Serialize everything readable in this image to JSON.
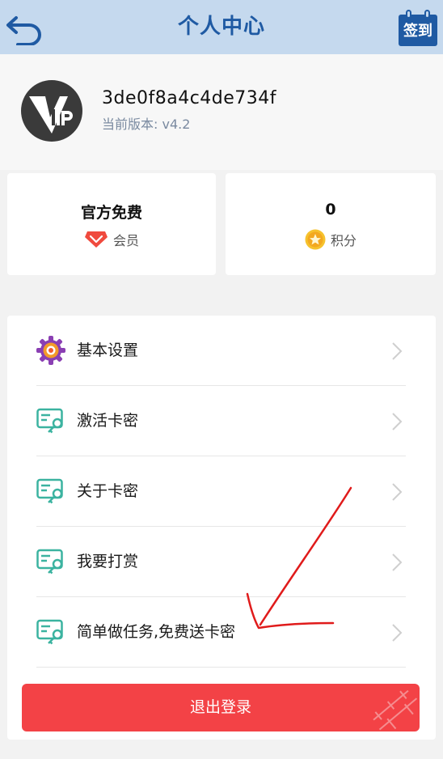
{
  "header": {
    "title": "个人中心",
    "checkin_label": "签到",
    "back_icon": "back-arrow-icon"
  },
  "profile": {
    "username": "3de0f8a4c4de734f",
    "version": "当前版本: v4.2",
    "avatar_icon": "vip-avatar-icon"
  },
  "stats": {
    "membership": {
      "value": "官方免费",
      "label": "会员",
      "icon": "diamond-icon"
    },
    "points": {
      "value": "0",
      "label": "积分",
      "icon": "star-coin-icon"
    }
  },
  "menu": {
    "items": [
      {
        "label": "基本设置",
        "icon": "settings-gear-icon"
      },
      {
        "label": "激活卡密",
        "icon": "card-key-icon"
      },
      {
        "label": "关于卡密",
        "icon": "card-key-icon"
      },
      {
        "label": "我要打赏",
        "icon": "card-key-icon"
      },
      {
        "label": "简单做任务,免费送卡密",
        "icon": "card-key-icon"
      }
    ]
  },
  "logout_label": "退出登录",
  "colors": {
    "header_bg": "#c5d9ee",
    "brand_blue": "#1f5aa3",
    "logout_red": "#f34246",
    "icon_teal": "#3bb3a0",
    "annotation_red": "#e01b1b"
  }
}
